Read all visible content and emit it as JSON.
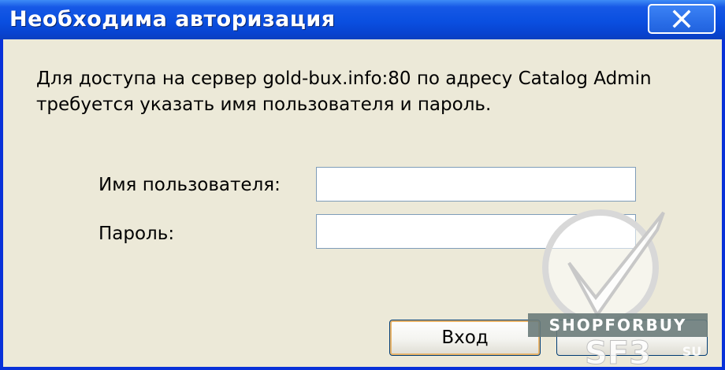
{
  "window": {
    "title": "Необходима авторизация"
  },
  "titlebar": {
    "close_icon": "close-x-icon"
  },
  "dialog": {
    "message": "Для доступа на сервер gold-bux.info:80 по адресу Catalog Admin требуется указать имя пользователя и пароль.",
    "username_label": "Имя пользователя:",
    "username_value": "",
    "password_label": "Пароль:",
    "password_value": ""
  },
  "buttons": {
    "login_label": "Вход"
  },
  "watermark": {
    "icon": "checkmark-icon",
    "banner_text": "SHOPFORBUY",
    "site_text": "SF3",
    "tld_text": "SU"
  },
  "colors": {
    "titlebar": "#0a4fe0",
    "frame": "#0831d9",
    "background": "#ece9d8",
    "field_border": "#7f9db9"
  }
}
